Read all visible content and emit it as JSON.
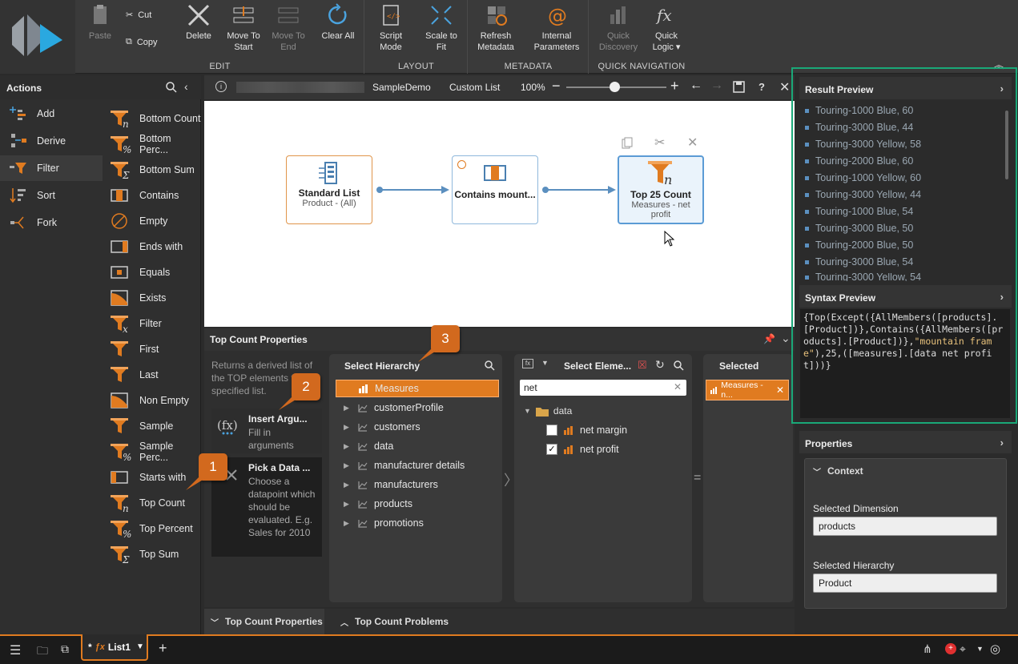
{
  "ribbon": {
    "edit_title": "EDIT",
    "layout_title": "LAYOUT",
    "metadata_title": "METADATA",
    "quicknav_title": "QUICK NAVIGATION",
    "paste": "Paste",
    "cut": "Cut",
    "copy": "Copy",
    "delete": "Delete",
    "move_to_start": "Move To Start",
    "move_to_end": "Move To End",
    "clear_all": "Clear All",
    "script_mode": "Script Mode",
    "scale_to_fit": "Scale to Fit",
    "refresh_metadata": "Refresh Metadata",
    "internal_parameters": "Internal Parameters",
    "quick_discovery": "Quick Discovery",
    "quick_logic": "Quick Logic ▾"
  },
  "actions": {
    "title": "Actions",
    "items": [
      "Add",
      "Derive",
      "Filter",
      "Sort",
      "Fork"
    ],
    "selected": "Filter",
    "filters": [
      "Bottom Count",
      "Bottom Perc...",
      "Bottom Sum",
      "Contains",
      "Empty",
      "Ends with",
      "Equals",
      "Exists",
      "Filter",
      "First",
      "Last",
      "Non Empty",
      "Sample",
      "Sample Perc...",
      "Starts with",
      "Top Count",
      "Top Percent",
      "Top Sum"
    ]
  },
  "canvas_bar": {
    "model": "SampleDemo",
    "list": "Custom List",
    "zoom": "100%"
  },
  "nodes": [
    {
      "title": "Standard List",
      "sub": "Product - (All)"
    },
    {
      "title": "Contains mount...",
      "sub": ""
    },
    {
      "title": "Top 25 Count",
      "sub": "Measures - net profit"
    }
  ],
  "props": {
    "title": "Top Count Properties",
    "description": "Returns a derived list of the TOP elements fr the specified list.",
    "insert_title": "Insert Argu...",
    "insert_desc": "Fill in arguments",
    "pick_title": "Pick a Data ...",
    "pick_desc": "Choose a datapoint which should be evaluated. E.g. Sales for 2010",
    "hierarchy_title": "Select Hierarchy",
    "hierarchies": [
      "Measures",
      "customerProfile",
      "customers",
      "data",
      "manufacturer details",
      "manufacturers",
      "products",
      "promotions"
    ],
    "elements_title": "Select Eleme...",
    "search_value": "net",
    "folder": "data",
    "elements": [
      {
        "label": "net margin",
        "checked": false
      },
      {
        "label": "net profit",
        "checked": true
      }
    ],
    "selected_title": "Selected",
    "selected_chip": "Measures - n...",
    "equals_sign": "="
  },
  "bottom_tabs": {
    "tab1": "Top Count Properties",
    "tab2": "Top Count Problems"
  },
  "callouts": [
    "1",
    "2",
    "3"
  ],
  "result": {
    "title": "Result Preview",
    "items": [
      "Touring-1000 Blue, 60",
      "Touring-3000 Blue, 44",
      "Touring-3000 Yellow, 58",
      "Touring-2000 Blue, 60",
      "Touring-1000 Yellow, 60",
      "Touring-3000 Yellow, 44",
      "Touring-1000 Blue, 54",
      "Touring-3000 Blue, 50",
      "Touring-2000 Blue, 50",
      "Touring-3000 Blue, 54",
      "Touring-3000 Yellow, 54"
    ]
  },
  "syntax": {
    "title": "Syntax Preview",
    "p1": "{Top(Except({AllMembers([products].[Product])},Contains({AllMembers([products].[Product])},",
    "p2": "\"mountain frame\"",
    "p3": "),25,([measures].[data net profit]))}"
  },
  "properties": {
    "title": "Properties",
    "context": "Context",
    "dim_label": "Selected Dimension",
    "dim_value": "products",
    "hier_label": "Selected Hierarchy",
    "hier_value": "Product"
  },
  "taskbar": {
    "tab": "List1",
    "modified": "*"
  },
  "colors": {
    "accent": "#e07b20",
    "frame": "#1aa878",
    "node_border": "#e0954a",
    "selected_node": "#5b9bd5"
  }
}
